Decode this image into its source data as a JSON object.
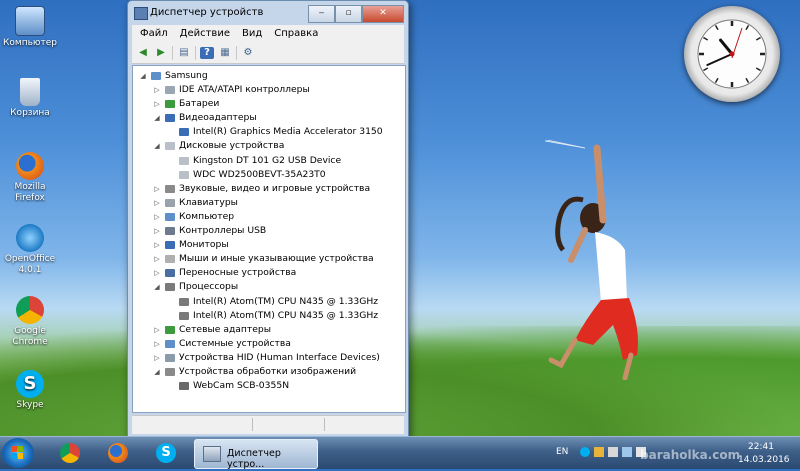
{
  "desktop": {
    "icons": [
      {
        "label": "Компьютер",
        "icon": "computer-icon"
      },
      {
        "label": "Корзина",
        "icon": "recycle-bin-icon"
      },
      {
        "label": "Mozilla Firefox",
        "icon": "firefox-icon"
      },
      {
        "label": "OpenOffice 4.0.1",
        "icon": "openoffice-icon"
      },
      {
        "label": "Google Chrome",
        "icon": "chrome-icon"
      },
      {
        "label": "Skype",
        "icon": "skype-icon"
      }
    ]
  },
  "clock": {
    "hour": 10,
    "minute": 41
  },
  "window": {
    "title": "Диспетчер устройств",
    "minimize": "‒",
    "maximize": "▫",
    "close": "✕",
    "menu": [
      "Файл",
      "Действие",
      "Вид",
      "Справка"
    ],
    "toolbar": [
      {
        "icon": "back-arrow-icon",
        "glyph": "◀"
      },
      {
        "icon": "forward-arrow-icon",
        "glyph": "▶"
      },
      {
        "icon": "properties-icon",
        "glyph": "▤"
      },
      {
        "icon": "help-icon",
        "glyph": "?"
      },
      {
        "icon": "view-icon",
        "glyph": "▦"
      },
      {
        "icon": "scan-hardware-icon",
        "glyph": "⚙"
      }
    ],
    "tree": [
      {
        "label": "Samsung",
        "level": 0,
        "expanded": true,
        "icon": "computer-icon"
      },
      {
        "label": "IDE ATA/ATAPI контроллеры",
        "level": 1,
        "expanded": false,
        "icon": "ide-controller-icon"
      },
      {
        "label": "Батареи",
        "level": 1,
        "expanded": false,
        "icon": "battery-icon"
      },
      {
        "label": "Видеоадаптеры",
        "level": 1,
        "expanded": true,
        "icon": "display-adapter-icon"
      },
      {
        "label": "Intel(R) Graphics Media Accelerator 3150",
        "level": 2,
        "icon": "display-adapter-icon"
      },
      {
        "label": "Дисковые устройства",
        "level": 1,
        "expanded": true,
        "icon": "disk-drive-icon"
      },
      {
        "label": "Kingston DT 101 G2 USB Device",
        "level": 2,
        "icon": "disk-drive-icon"
      },
      {
        "label": "WDC WD2500BEVT-35A23T0",
        "level": 2,
        "icon": "disk-drive-icon"
      },
      {
        "label": "Звуковые, видео и игровые устройства",
        "level": 1,
        "expanded": false,
        "icon": "sound-icon"
      },
      {
        "label": "Клавиатуры",
        "level": 1,
        "expanded": false,
        "icon": "keyboard-icon"
      },
      {
        "label": "Компьютер",
        "level": 1,
        "expanded": false,
        "icon": "computer-icon"
      },
      {
        "label": "Контроллеры USB",
        "level": 1,
        "expanded": false,
        "icon": "usb-icon"
      },
      {
        "label": "Мониторы",
        "level": 1,
        "expanded": false,
        "icon": "monitor-icon"
      },
      {
        "label": "Мыши и иные указывающие устройства",
        "level": 1,
        "expanded": false,
        "icon": "mouse-icon"
      },
      {
        "label": "Переносные устройства",
        "level": 1,
        "expanded": false,
        "icon": "portable-device-icon"
      },
      {
        "label": "Процессоры",
        "level": 1,
        "expanded": true,
        "icon": "processor-icon"
      },
      {
        "label": "Intel(R) Atom(TM) CPU N435   @ 1.33GHz",
        "level": 2,
        "icon": "processor-icon"
      },
      {
        "label": "Intel(R) Atom(TM) CPU N435   @ 1.33GHz",
        "level": 2,
        "icon": "processor-icon"
      },
      {
        "label": "Сетевые адаптеры",
        "level": 1,
        "expanded": false,
        "icon": "network-adapter-icon"
      },
      {
        "label": "Системные устройства",
        "level": 1,
        "expanded": false,
        "icon": "system-device-icon"
      },
      {
        "label": "Устройства HID (Human Interface Devices)",
        "level": 1,
        "expanded": false,
        "icon": "hid-icon"
      },
      {
        "label": "Устройства обработки изображений",
        "level": 1,
        "expanded": true,
        "icon": "imaging-device-icon"
      },
      {
        "label": "WebCam SCB-0355N",
        "level": 2,
        "icon": "webcam-icon"
      }
    ]
  },
  "taskbar": {
    "pinned": [
      {
        "icon": "chrome-icon"
      },
      {
        "icon": "firefox-icon"
      },
      {
        "icon": "skype-icon"
      }
    ],
    "active_task": "Диспетчер устро...",
    "language": "EN",
    "time": "22:41",
    "date": "14.03.2016"
  },
  "watermark": "baraholka.com",
  "colors": {
    "window_frame": "#c5d6ea",
    "taskbar": "#3d5f88",
    "close_button": "#c8492f"
  }
}
